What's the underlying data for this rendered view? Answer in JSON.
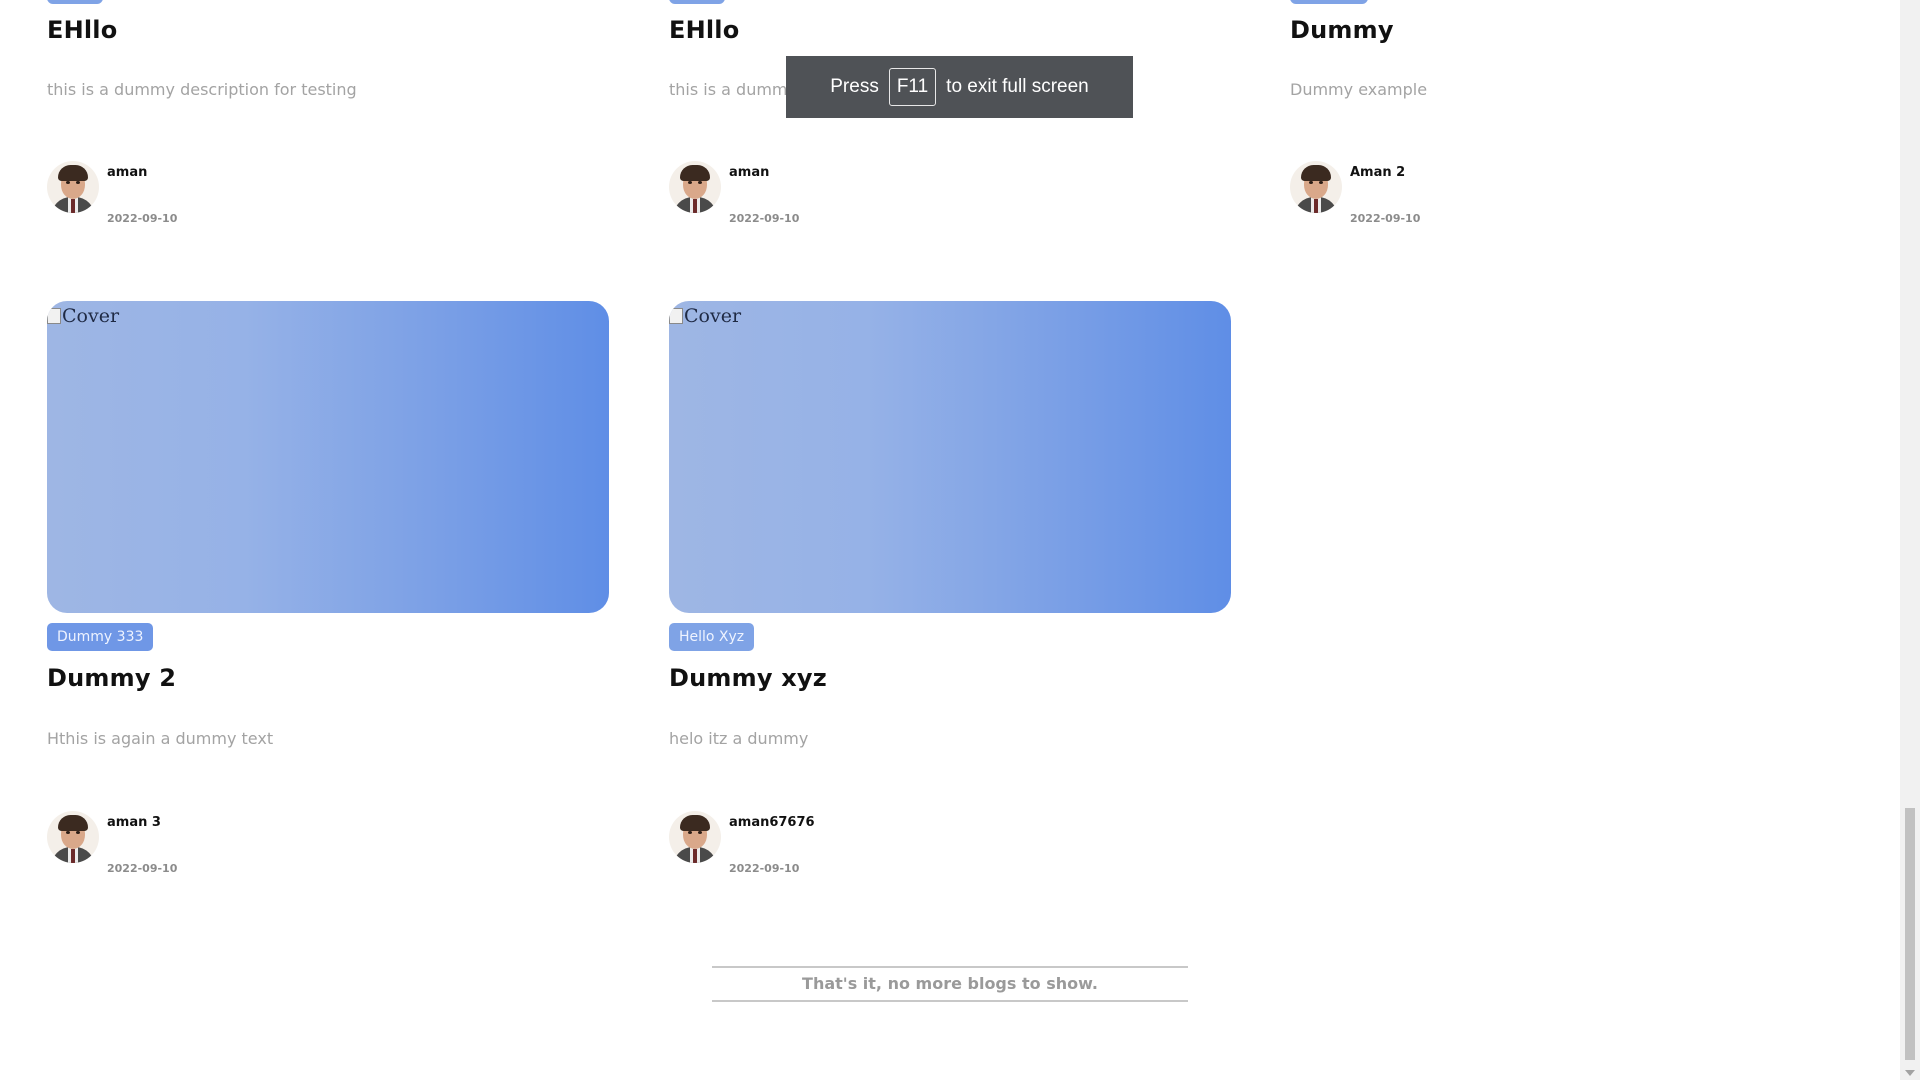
{
  "top_row": [
    {
      "title": "EHllo",
      "description": "this is a dummy description for testing",
      "author": "aman",
      "date": "2022-09-10"
    },
    {
      "title": "EHllo",
      "description": "this is a dummy description for testing",
      "author": "aman",
      "date": "2022-09-10"
    },
    {
      "title": "Dummy",
      "description": "Dummy example",
      "author": "Aman 2",
      "date": "2022-09-10"
    }
  ],
  "bottom_row": [
    {
      "cover_alt": "Cover",
      "tag": "Dummy 333",
      "title": "Dummy 2",
      "description": "Hthis is again a dummy text",
      "author": "aman 3",
      "date": "2022-09-10"
    },
    {
      "cover_alt": "Cover",
      "tag": "Hello Xyz",
      "title": "Dummy xyz",
      "description": "helo itz a dummy",
      "author": "aman67676",
      "date": "2022-09-10"
    }
  ],
  "end_message": "That's it, no more blogs to show.",
  "fullscreen_toast": {
    "prefix": "Press",
    "key": "F11",
    "suffix": "to exit full screen"
  },
  "colors": {
    "tag_bg": "#6f97e6",
    "cover_gradient_start": "#9eb6e4",
    "cover_gradient_end": "#5f8ee6"
  }
}
